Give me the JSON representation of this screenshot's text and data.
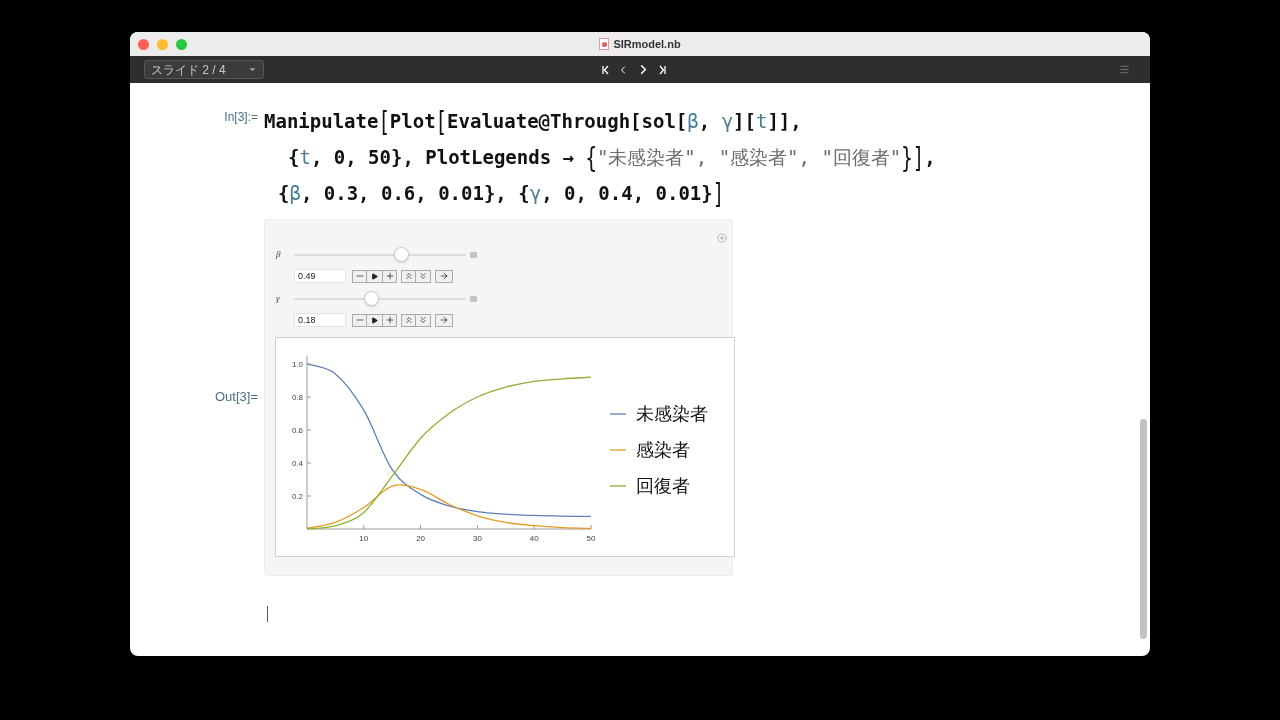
{
  "window": {
    "title": "SIRmodel.nb"
  },
  "toolbar": {
    "slide_selector": "スライド 2 / 4"
  },
  "input": {
    "label": "In[3]:=",
    "lines": [
      [
        {
          "kind": "plain",
          "text": "Manipulate"
        },
        {
          "kind": "bracket",
          "text": "["
        },
        {
          "kind": "plain",
          "text": "Plot"
        },
        {
          "kind": "bracket",
          "text": "["
        },
        {
          "kind": "plain",
          "text": "Evaluate@Through[sol["
        },
        {
          "kind": "var",
          "text": "β"
        },
        {
          "kind": "plain",
          "text": ", "
        },
        {
          "kind": "var",
          "text": "γ"
        },
        {
          "kind": "plain",
          "text": "]["
        },
        {
          "kind": "var",
          "text": "t"
        },
        {
          "kind": "plain",
          "text": "]],"
        }
      ],
      [
        {
          "kind": "plain",
          "text": "{"
        },
        {
          "kind": "var",
          "text": "t"
        },
        {
          "kind": "plain",
          "text": ", 0, 50}, PlotLegends → "
        },
        {
          "kind": "bracket",
          "text": "{"
        },
        {
          "kind": "string",
          "text": "\"未感染者\", \"感染者\", \"回復者\""
        },
        {
          "kind": "bracket",
          "text": "}"
        },
        {
          "kind": "bracket",
          "text": "]"
        },
        {
          "kind": "plain",
          "text": ","
        }
      ],
      [
        {
          "kind": "plain",
          "text": "{"
        },
        {
          "kind": "var",
          "text": "β"
        },
        {
          "kind": "plain",
          "text": ", 0.3, 0.6, 0.01}, {"
        },
        {
          "kind": "var",
          "text": "γ"
        },
        {
          "kind": "plain",
          "text": ", 0, 0.4, 0.01}"
        },
        {
          "kind": "bracket",
          "text": "]"
        }
      ]
    ]
  },
  "output": {
    "label": "Out[3]=",
    "sliders": [
      {
        "name": "β",
        "level": 0.62,
        "value": "0.49"
      },
      {
        "name": "γ",
        "level": 0.45,
        "value": "0.18"
      }
    ],
    "chart_data": {
      "type": "line",
      "x": [
        0,
        5,
        10,
        15,
        20,
        25,
        30,
        35,
        40,
        45,
        50
      ],
      "xlim": [
        0,
        50
      ],
      "ylim": [
        0,
        1.05
      ],
      "legend": "right",
      "xticks": [
        10,
        20,
        30,
        40,
        50
      ],
      "yticks": [
        0.2,
        0.4,
        0.6,
        0.8,
        {
          "value": 1,
          "label": "1.0"
        }
      ],
      "series": [
        {
          "name": "未感染者",
          "color": "#5e81b5",
          "values": [
            1.0,
            0.94,
            0.72,
            0.36,
            0.21,
            0.14,
            0.105,
            0.09,
            0.082,
            0.078,
            0.076
          ]
        },
        {
          "name": "感染者",
          "color": "#e19c24",
          "values": [
            0.005,
            0.04,
            0.13,
            0.26,
            0.24,
            0.15,
            0.08,
            0.04,
            0.02,
            0.008,
            0.003
          ]
        },
        {
          "name": "回復者",
          "color": "#8fb032",
          "values": [
            0.0,
            0.02,
            0.1,
            0.32,
            0.55,
            0.7,
            0.8,
            0.86,
            0.895,
            0.91,
            0.92
          ]
        }
      ]
    }
  }
}
